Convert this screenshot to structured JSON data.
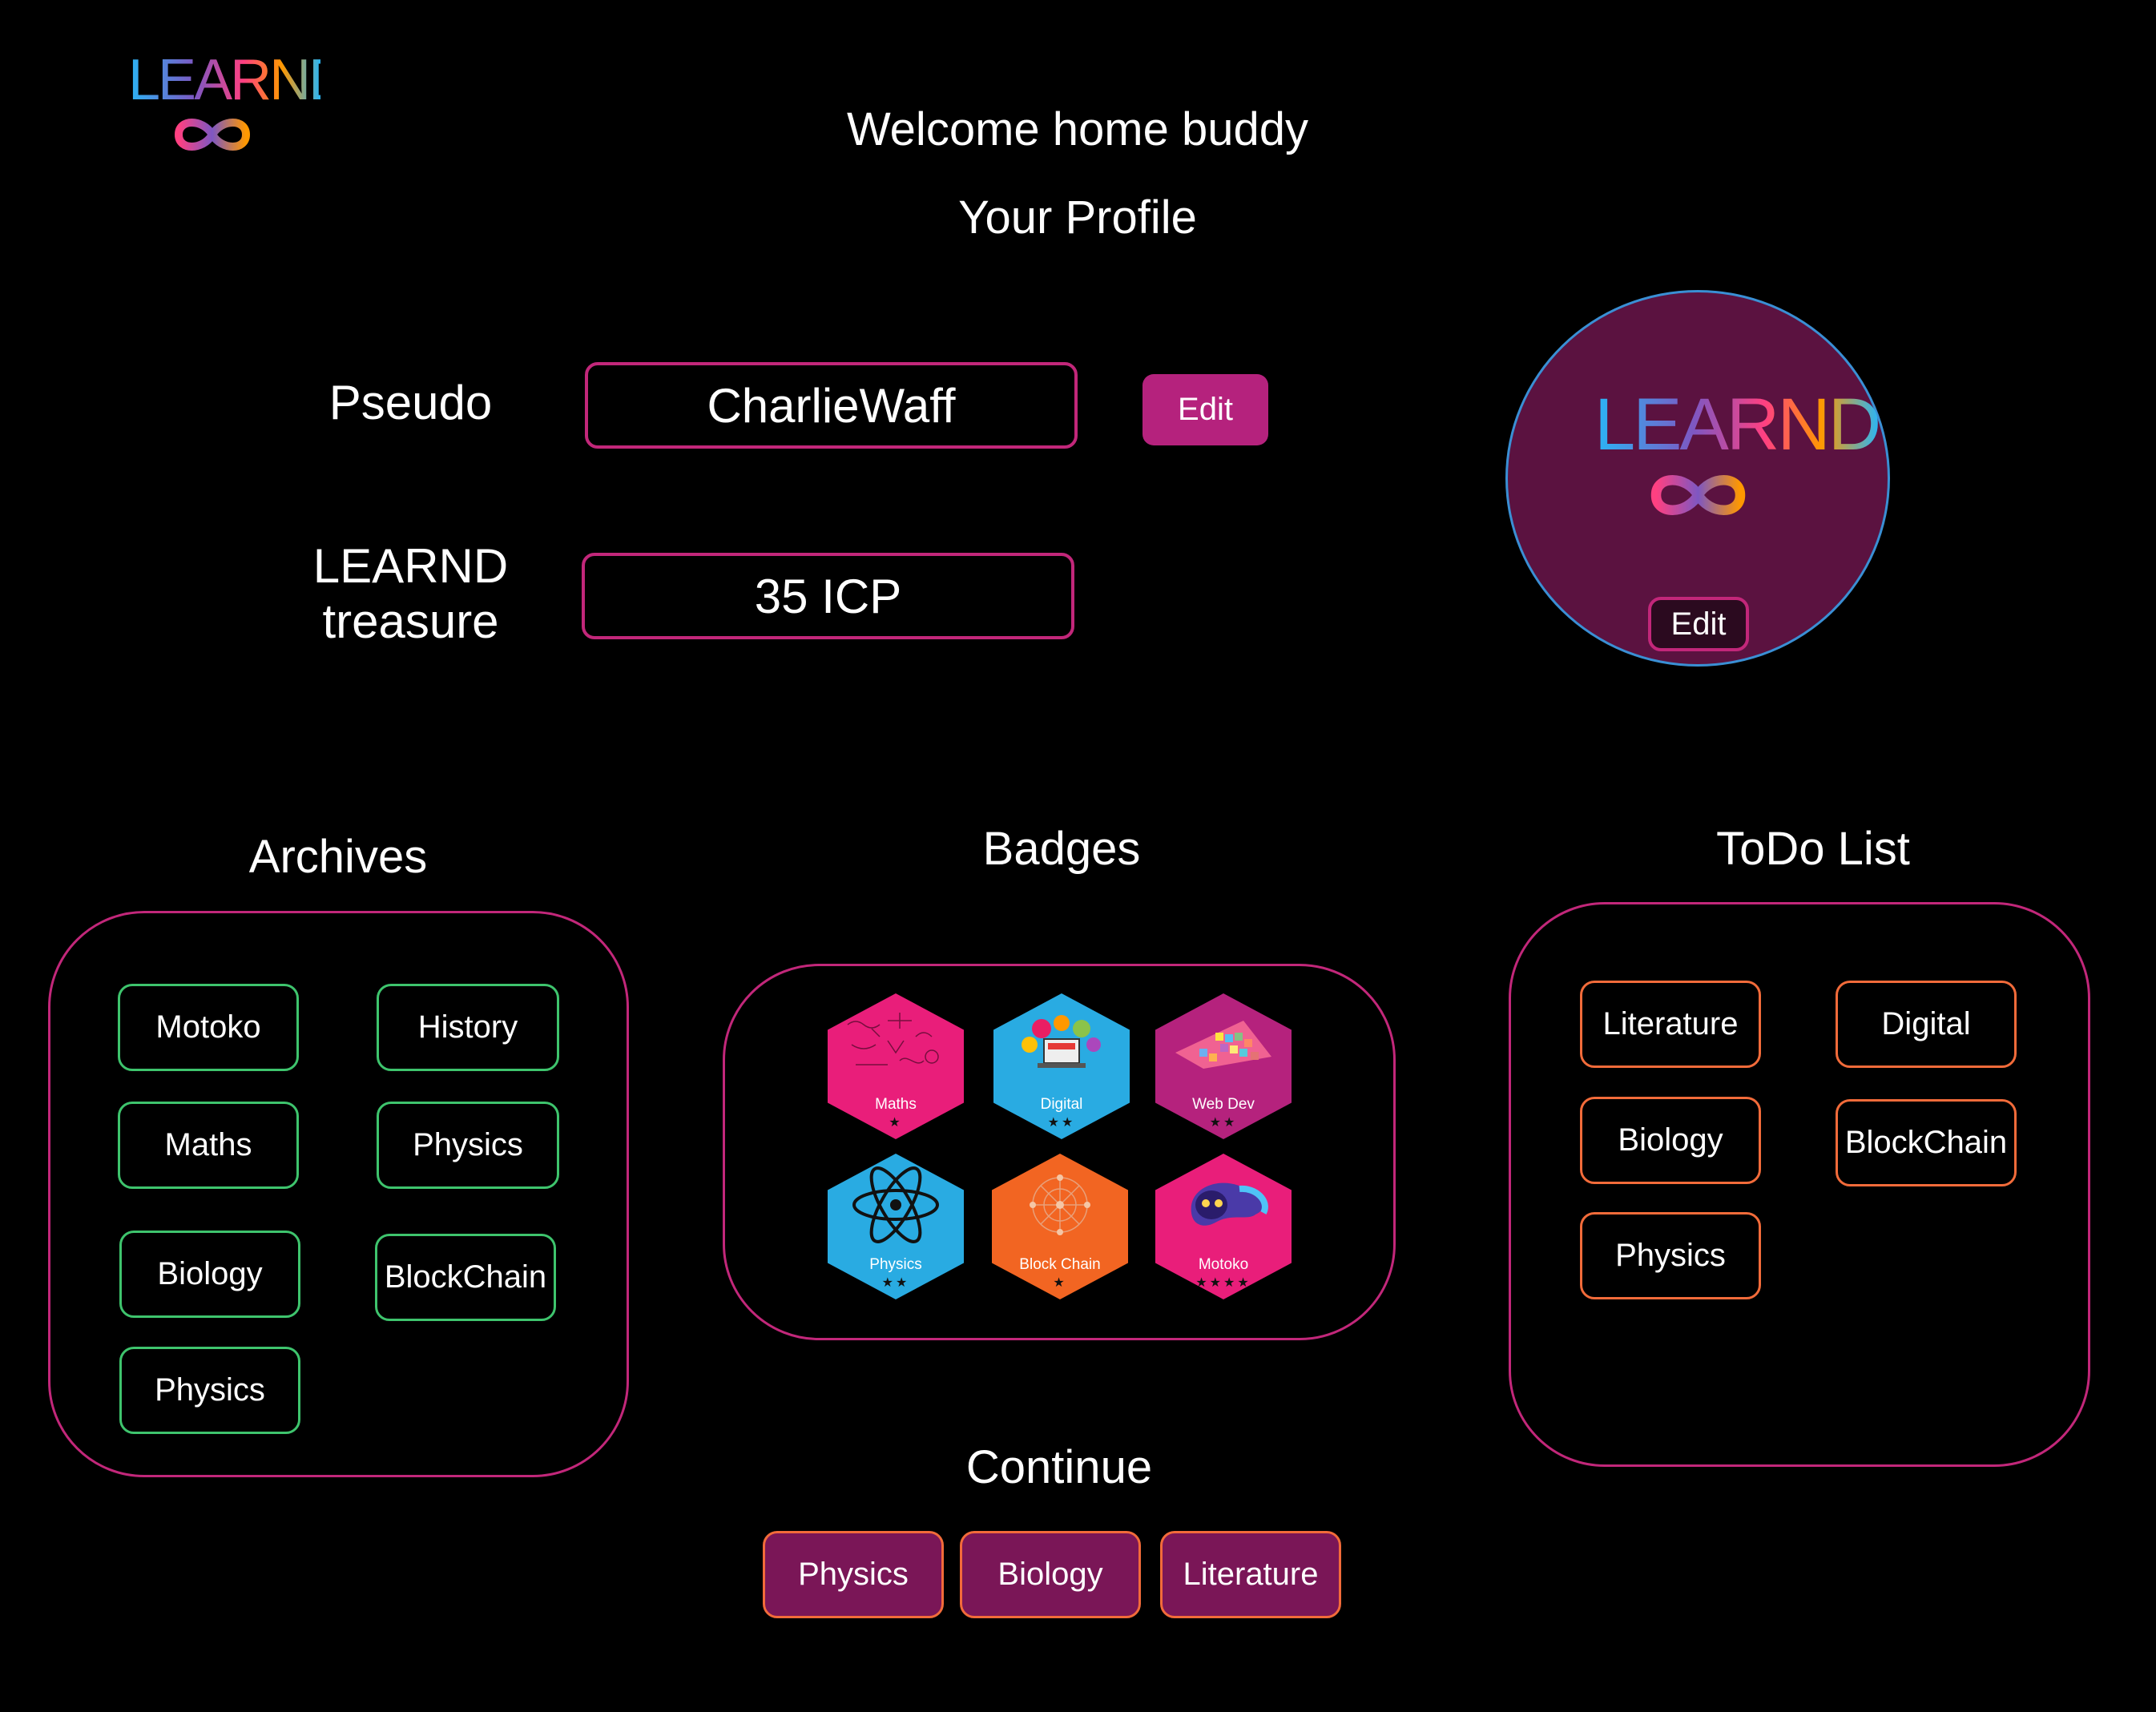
{
  "brand": {
    "logo_text": "LEARND",
    "logo_icon": "infinity-icon",
    "colors": {
      "blue": "#29b6f6",
      "pink": "#ff4081",
      "orange": "#ff9800",
      "accent": "#c2277a"
    }
  },
  "header": {
    "welcome": "Welcome home buddy",
    "subtitle": "Your Profile"
  },
  "profile": {
    "pseudo_label": "Pseudo",
    "pseudo_value": "CharlieWaff",
    "pseudo_edit_label": "Edit",
    "treasure_label_line1": "LEARND",
    "treasure_label_line2": "treasure",
    "treasure_value": "35 ICP",
    "avatar_edit_label": "Edit"
  },
  "archives": {
    "title": "Archives",
    "items": [
      "Motoko",
      "History",
      "Maths",
      "Physics",
      "Biology",
      "BlockChain",
      "Physics"
    ]
  },
  "badges": {
    "title": "Badges",
    "items": [
      {
        "label": "Maths",
        "stars": "★",
        "color": "#e91e7a",
        "icon": "math-formulas-icon"
      },
      {
        "label": "Digital",
        "stars": "★★",
        "color": "#29abe2",
        "icon": "laptop-code-icon"
      },
      {
        "label": "Web Dev",
        "stars": "★★",
        "color": "#b5227d",
        "icon": "pixel-grid-icon"
      },
      {
        "label": "Physics",
        "stars": "★★",
        "color": "#29abe2",
        "icon": "atom-icon"
      },
      {
        "label": "Block Chain",
        "stars": "★",
        "color": "#f26522",
        "icon": "network-icon"
      },
      {
        "label": "Motoko",
        "stars": "★★★★",
        "color": "#e91e7a",
        "icon": "motoko-ghost-icon"
      }
    ]
  },
  "todo": {
    "title": "ToDo List",
    "items": [
      "Literature",
      "Digital",
      "Biology",
      "BlockChain",
      "Physics"
    ]
  },
  "continue": {
    "title": "Continue",
    "items": [
      "Physics",
      "Biology",
      "Literature"
    ]
  }
}
